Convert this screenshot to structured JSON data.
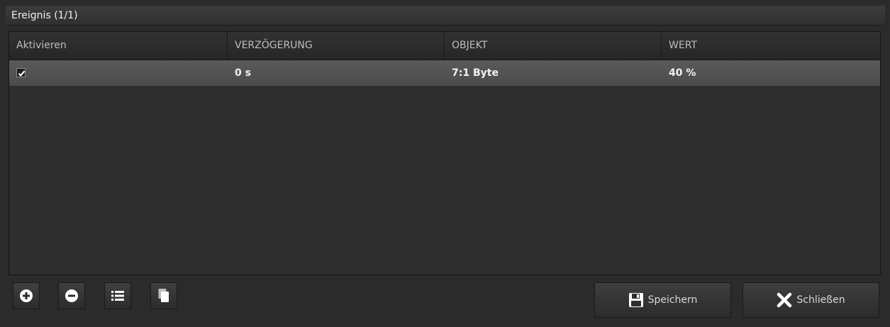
{
  "window": {
    "title": "Ereignis (1/1)"
  },
  "table": {
    "columns": [
      "Aktivieren",
      "VERZÖGERUNG",
      "OBJEKT",
      "WERT"
    ],
    "rows": [
      {
        "active": true,
        "delay": "0 s",
        "object": "7:1 Byte",
        "value": "40 %"
      }
    ]
  },
  "toolbar": {
    "icons": [
      "plus-circle-icon",
      "minus-circle-icon",
      "list-icon",
      "copy-icon"
    ]
  },
  "buttons": {
    "save_label": "Speichern",
    "close_label": "Schließen"
  },
  "colors": {
    "background": "#2b2b2b",
    "selected_row": "#555555",
    "text": "#e8e8e8"
  }
}
